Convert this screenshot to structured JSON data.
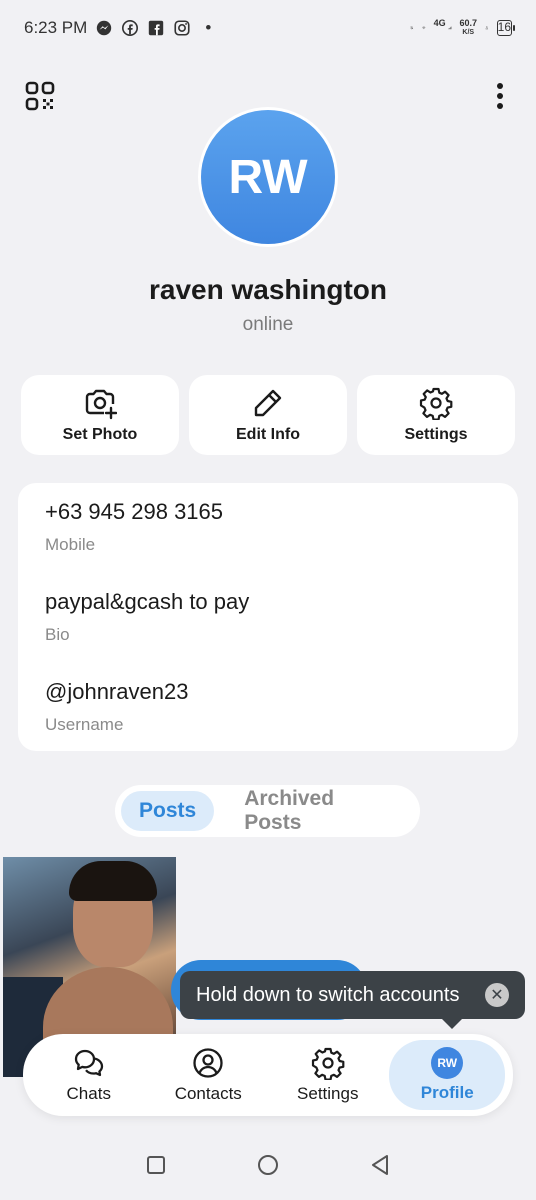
{
  "status_bar": {
    "time": "6:23 PM",
    "dot": "•",
    "network_label": "4G",
    "net_speed_value": "60.7",
    "net_speed_unit": "K/S",
    "battery": "16"
  },
  "profile": {
    "initials": "RW",
    "name": "raven washington",
    "status": "online",
    "avatar_color": "#3f86e0"
  },
  "actions": {
    "set_photo": "Set Photo",
    "edit_info": "Edit Info",
    "settings": "Settings"
  },
  "info": [
    {
      "value": "+63 945 298 3165",
      "label": "Mobile"
    },
    {
      "value": "paypal&gcash to pay",
      "label": "Bio"
    },
    {
      "value": "@johnraven23",
      "label": "Username"
    }
  ],
  "tabs": {
    "posts": "Posts",
    "archived": "Archived Posts"
  },
  "tooltip": {
    "text": "Hold down to switch accounts",
    "close": "✕"
  },
  "nav": {
    "chats": "Chats",
    "contacts": "Contacts",
    "settings": "Settings",
    "profile": "Profile",
    "profile_initials": "RW"
  },
  "colors": {
    "accent": "#2f86d8",
    "accent_light": "#dcebfa",
    "background": "#f1f1f4"
  }
}
